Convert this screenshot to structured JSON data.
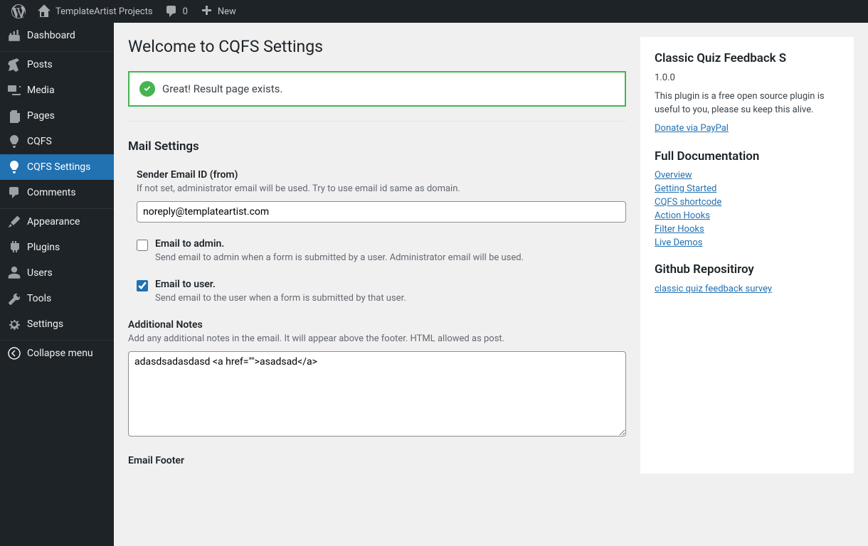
{
  "adminbar": {
    "site_name": "TemplateArtist Projects",
    "comments_count": "0",
    "new_label": "New"
  },
  "menu": {
    "dashboard": "Dashboard",
    "posts": "Posts",
    "media": "Media",
    "pages": "Pages",
    "cqfs": "CQFS",
    "cqfs_settings": "CQFS Settings",
    "comments": "Comments",
    "appearance": "Appearance",
    "plugins": "Plugins",
    "users": "Users",
    "tools": "Tools",
    "settings": "Settings",
    "collapse": "Collapse menu"
  },
  "page": {
    "title": "Welcome to CQFS Settings",
    "notice": "Great! Result page exists.",
    "mail_heading": "Mail Settings",
    "sender_label": "Sender Email ID (from)",
    "sender_help": "If not set, administrator email will be used. Try to use email id same as domain.",
    "sender_value": "noreply@templateartist.com",
    "email_admin_label": "Email to admin.",
    "email_admin_help": "Send email to admin when a form is submitted by a user. Administrator email will be used.",
    "email_admin_checked": false,
    "email_user_label": "Email to user.",
    "email_user_help": "Send email to the user when a form is submitted by that user.",
    "email_user_checked": true,
    "notes_label": "Additional Notes",
    "notes_help": "Add any additional notes in the email. It will appear above the footer. HTML allowed as post.",
    "notes_value": "adasdsadasdasd <a href=\"\">asadsad</a>",
    "footer_label": "Email Footer"
  },
  "sidebar": {
    "plugin_title": "Classic Quiz Feedback S",
    "version": "1.0.0",
    "desc": "This plugin is a free open source plugin is useful to you, please su keep this alive.",
    "donate": "Donate via PayPal",
    "docs_heading": "Full Documentation",
    "docs": {
      "overview": "Overview",
      "getting_started": "Getting Started",
      "shortcode": "CQFS shortcode",
      "action_hooks": "Action Hooks",
      "filter_hooks": "Filter Hooks",
      "live_demos": "Live Demos"
    },
    "github_heading": "Github Repositiroy",
    "github_link": "classic quiz feedback survey"
  }
}
